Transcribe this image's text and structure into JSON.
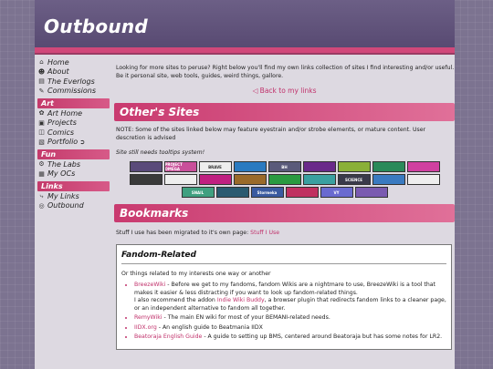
{
  "site": {
    "title": "Outbound"
  },
  "nav": {
    "group1": [
      {
        "label": "Home",
        "icon": "home-icon"
      },
      {
        "label": "About",
        "icon": "person-icon"
      },
      {
        "label": "The Everlogs",
        "icon": "document-icon"
      },
      {
        "label": "Commissions",
        "icon": "edit-icon"
      }
    ],
    "art": {
      "heading": "Art",
      "items": [
        {
          "label": "Art Home",
          "icon": "palette-icon"
        },
        {
          "label": "Projects",
          "icon": "image-icon"
        },
        {
          "label": "Comics",
          "icon": "book-icon"
        },
        {
          "label": "Portfolio",
          "icon": "portfolio-icon"
        }
      ]
    },
    "fun": {
      "heading": "Fun",
      "items": [
        {
          "label": "The Labs",
          "icon": "lab-icon"
        },
        {
          "label": "My OCs",
          "icon": "id-card-icon"
        }
      ]
    },
    "links": {
      "heading": "Links",
      "items": [
        {
          "label": "My Links",
          "icon": "share-icon"
        },
        {
          "label": "Outbound",
          "icon": "globe-icon"
        }
      ]
    }
  },
  "main": {
    "intro": "Looking for more sites to peruse? Right below you'll find my own links collection of sites I find interesting and/or useful. Be it personal site, web tools, guides, weird things, gallore.",
    "back_link": "Back to my links",
    "others_heading": "Other's Sites",
    "note": "NOTE: Some of the sites linked below may feature eyestrain and/or strobe elements, or mature content. User descretion is advised",
    "tooltip_note": "Site still needs tooltips system!",
    "buttons": [
      {
        "label": "",
        "color": "#5a4a7a"
      },
      {
        "label": "PROJECT OMEGA",
        "color": "#c94f9a"
      },
      {
        "label": "BRAVE",
        "color": "#eeeeee"
      },
      {
        "label": "",
        "color": "#2a7ac0"
      },
      {
        "label": "BH",
        "color": "#5a5a7a"
      },
      {
        "label": "",
        "color": "#6a2a8a"
      },
      {
        "label": "",
        "color": "#8ab038"
      },
      {
        "label": "",
        "color": "#2a8a5a"
      },
      {
        "label": "",
        "color": "#d040a0"
      },
      {
        "label": "",
        "color": "#3a3a3a"
      },
      {
        "label": "",
        "color": "#eeeeee"
      },
      {
        "label": "",
        "color": "#c02080"
      },
      {
        "label": "",
        "color": "#9a6a2a"
      },
      {
        "label": "",
        "color": "#2a9a40"
      },
      {
        "label": "",
        "color": "#3aa0a0"
      },
      {
        "label": "SCIENCE",
        "color": "#3a3a4a"
      },
      {
        "label": "",
        "color": "#3a7ac0"
      },
      {
        "label": "",
        "color": "#eeeeee"
      },
      {
        "label": "SNAIL",
        "color": "#40a080"
      },
      {
        "label": "",
        "color": "#2a5a70"
      },
      {
        "label": "Stormeka",
        "color": "#3a5aa0"
      },
      {
        "label": "",
        "color": "#c03060"
      },
      {
        "label": "VY",
        "color": "#6a6ad0"
      },
      {
        "label": "",
        "color": "#7a5ab0"
      }
    ],
    "bookmarks_heading": "Bookmarks",
    "stuff_text": "Stuff I use has been migrated to it's own page:",
    "stuff_link": "Stuff I Use",
    "fandom": {
      "heading": "Fandom-Related",
      "sub": "Or things related to my interests one way or another",
      "items": [
        {
          "link": "BreezeWiki",
          "text": " - Before we get to my fandoms, fandom Wikis are a nightmare to use, BreezeWiki is a tool that makes it easier & less distracting if you want to look up fandom-related things.",
          "extra_pre": "I also recommend the addon ",
          "extra_link": "Indie Wiki Buddy",
          "extra_post": ", a browser plugin that redirects fandom links to a cleaner page, or an independent alternative to fandom all together."
        },
        {
          "link": "RemyWiki",
          "text": " - The main EN wiki for most of your BEMANI-related needs."
        },
        {
          "link": "IIDX.org",
          "text": " - An english guide to Beatmania IIDX"
        },
        {
          "link": "Beatoraja English Guide",
          "text": " - A guide to setting up BMS, centered around Beatoraja but has some notes for LR2."
        }
      ]
    }
  }
}
